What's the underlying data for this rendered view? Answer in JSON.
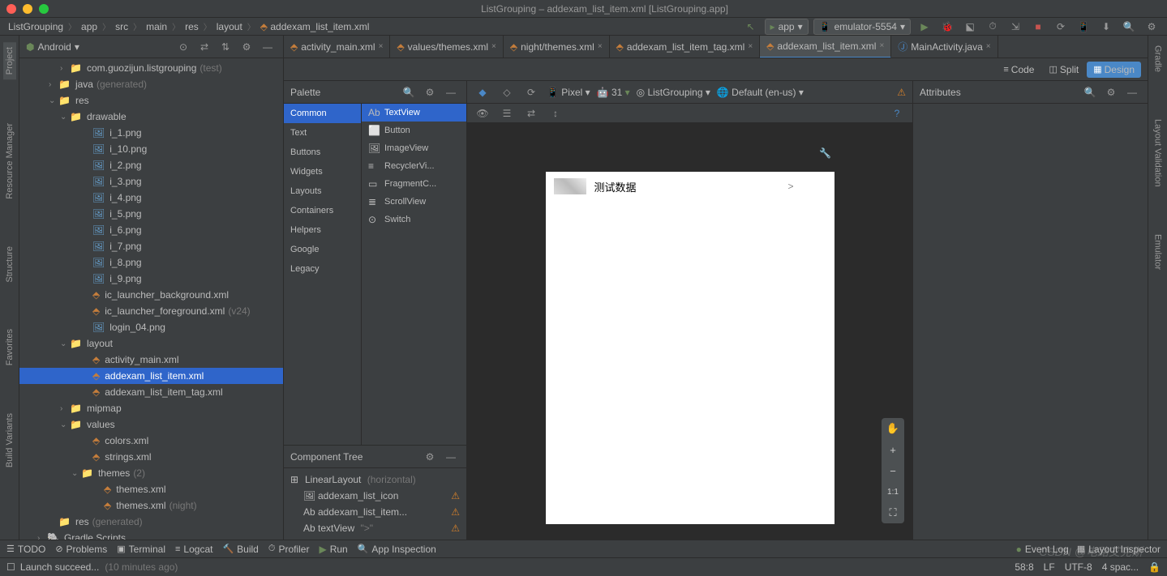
{
  "window": {
    "title": "ListGrouping – addexam_list_item.xml [ListGrouping.app]"
  },
  "breadcrumb": [
    "ListGrouping",
    "app",
    "src",
    "main",
    "res",
    "layout",
    "addexam_list_item.xml"
  ],
  "run_config": "app",
  "device_selector": "emulator-5554",
  "sidebar": {
    "view": "Android"
  },
  "tree": [
    {
      "label": "com.guozijun.listgrouping",
      "hint": "(test)",
      "indent": 3,
      "arrow": "›",
      "icon": "folder"
    },
    {
      "label": "java",
      "hint": "(generated)",
      "indent": 2,
      "arrow": "›",
      "icon": "folder"
    },
    {
      "label": "res",
      "indent": 2,
      "arrow": "⌄",
      "icon": "folder"
    },
    {
      "label": "drawable",
      "indent": 3,
      "arrow": "⌄",
      "icon": "folder"
    },
    {
      "label": "i_1.png",
      "indent": 5,
      "icon": "img"
    },
    {
      "label": "i_10.png",
      "indent": 5,
      "icon": "img"
    },
    {
      "label": "i_2.png",
      "indent": 5,
      "icon": "img"
    },
    {
      "label": "i_3.png",
      "indent": 5,
      "icon": "img"
    },
    {
      "label": "i_4.png",
      "indent": 5,
      "icon": "img"
    },
    {
      "label": "i_5.png",
      "indent": 5,
      "icon": "img"
    },
    {
      "label": "i_6.png",
      "indent": 5,
      "icon": "img"
    },
    {
      "label": "i_7.png",
      "indent": 5,
      "icon": "img"
    },
    {
      "label": "i_8.png",
      "indent": 5,
      "icon": "img"
    },
    {
      "label": "i_9.png",
      "indent": 5,
      "icon": "img"
    },
    {
      "label": "ic_launcher_background.xml",
      "indent": 5,
      "icon": "xml"
    },
    {
      "label": "ic_launcher_foreground.xml",
      "hint": "(v24)",
      "indent": 5,
      "icon": "xml"
    },
    {
      "label": "login_04.png",
      "indent": 5,
      "icon": "img"
    },
    {
      "label": "layout",
      "indent": 3,
      "arrow": "⌄",
      "icon": "folder"
    },
    {
      "label": "activity_main.xml",
      "indent": 5,
      "icon": "xml"
    },
    {
      "label": "addexam_list_item.xml",
      "indent": 5,
      "icon": "xml",
      "selected": true
    },
    {
      "label": "addexam_list_item_tag.xml",
      "indent": 5,
      "icon": "xml"
    },
    {
      "label": "mipmap",
      "indent": 3,
      "arrow": "›",
      "icon": "folder"
    },
    {
      "label": "values",
      "indent": 3,
      "arrow": "⌄",
      "icon": "folder"
    },
    {
      "label": "colors.xml",
      "indent": 5,
      "icon": "xml"
    },
    {
      "label": "strings.xml",
      "indent": 5,
      "icon": "xml"
    },
    {
      "label": "themes",
      "hint": "(2)",
      "indent": 4,
      "arrow": "⌄",
      "icon": "folder"
    },
    {
      "label": "themes.xml",
      "indent": 6,
      "icon": "xml"
    },
    {
      "label": "themes.xml",
      "hint": "(night)",
      "indent": 6,
      "icon": "xml"
    },
    {
      "label": "res",
      "hint": "(generated)",
      "indent": 2,
      "icon": "folder"
    },
    {
      "label": "Gradle Scripts",
      "indent": 1,
      "arrow": "›",
      "icon": "gradle"
    }
  ],
  "tabs": [
    {
      "label": "activity_main.xml",
      "icon": "xml"
    },
    {
      "label": "values/themes.xml",
      "icon": "xml"
    },
    {
      "label": "night/themes.xml",
      "icon": "xml"
    },
    {
      "label": "addexam_list_item_tag.xml",
      "icon": "xml"
    },
    {
      "label": "addexam_list_item.xml",
      "icon": "xml",
      "active": true
    },
    {
      "label": "MainActivity.java",
      "icon": "java"
    }
  ],
  "view_modes": {
    "code": "Code",
    "split": "Split",
    "design": "Design"
  },
  "palette": {
    "title": "Palette",
    "cats": [
      "Common",
      "Text",
      "Buttons",
      "Widgets",
      "Layouts",
      "Containers",
      "Helpers",
      "Google",
      "Legacy"
    ],
    "items": [
      "TextView",
      "Button",
      "ImageView",
      "RecyclerVi...",
      "FragmentC...",
      "ScrollView",
      "Switch"
    ]
  },
  "canvas_toolbar": {
    "device": "Pixel",
    "api": "31",
    "theme": "ListGrouping",
    "locale": "Default (en-us)"
  },
  "comp_tree": {
    "title": "Component Tree",
    "items": [
      {
        "label": "LinearLayout",
        "hint": "(horizontal)",
        "icon": "layout"
      },
      {
        "label": "addexam_list_icon",
        "icon": "img",
        "warn": true,
        "indent": 1
      },
      {
        "label": "addexam_list_item...",
        "icon": "text",
        "warn": true,
        "indent": 1
      },
      {
        "label": "textView",
        "hint": "\">\"",
        "icon": "text",
        "warn": true,
        "indent": 1
      }
    ]
  },
  "preview": {
    "text": "测试数据",
    "arrow": ">"
  },
  "attrs": {
    "title": "Attributes"
  },
  "bottom": {
    "items": [
      "TODO",
      "Problems",
      "Terminal",
      "Logcat",
      "Build",
      "Profiler",
      "Run",
      "App Inspection"
    ],
    "event_log": "Event Log",
    "layout_insp": "Layout Inspector"
  },
  "status": {
    "msg": "Launch succeed...",
    "ago": "(10 minutes ago)",
    "pos": "58:8",
    "lf": "LF",
    "enc": "UTF-8",
    "indent": "4 spac..."
  },
  "left_tools": [
    "Project",
    "Resource Manager",
    "Structure",
    "Favorites",
    "Build Variants"
  ],
  "right_tools": [
    "Gradle",
    "Layout Validation",
    "Emulator"
  ],
  "zoom": {
    "ratio": "1:1"
  },
  "watermark": "CSDN @电路艾克斯"
}
